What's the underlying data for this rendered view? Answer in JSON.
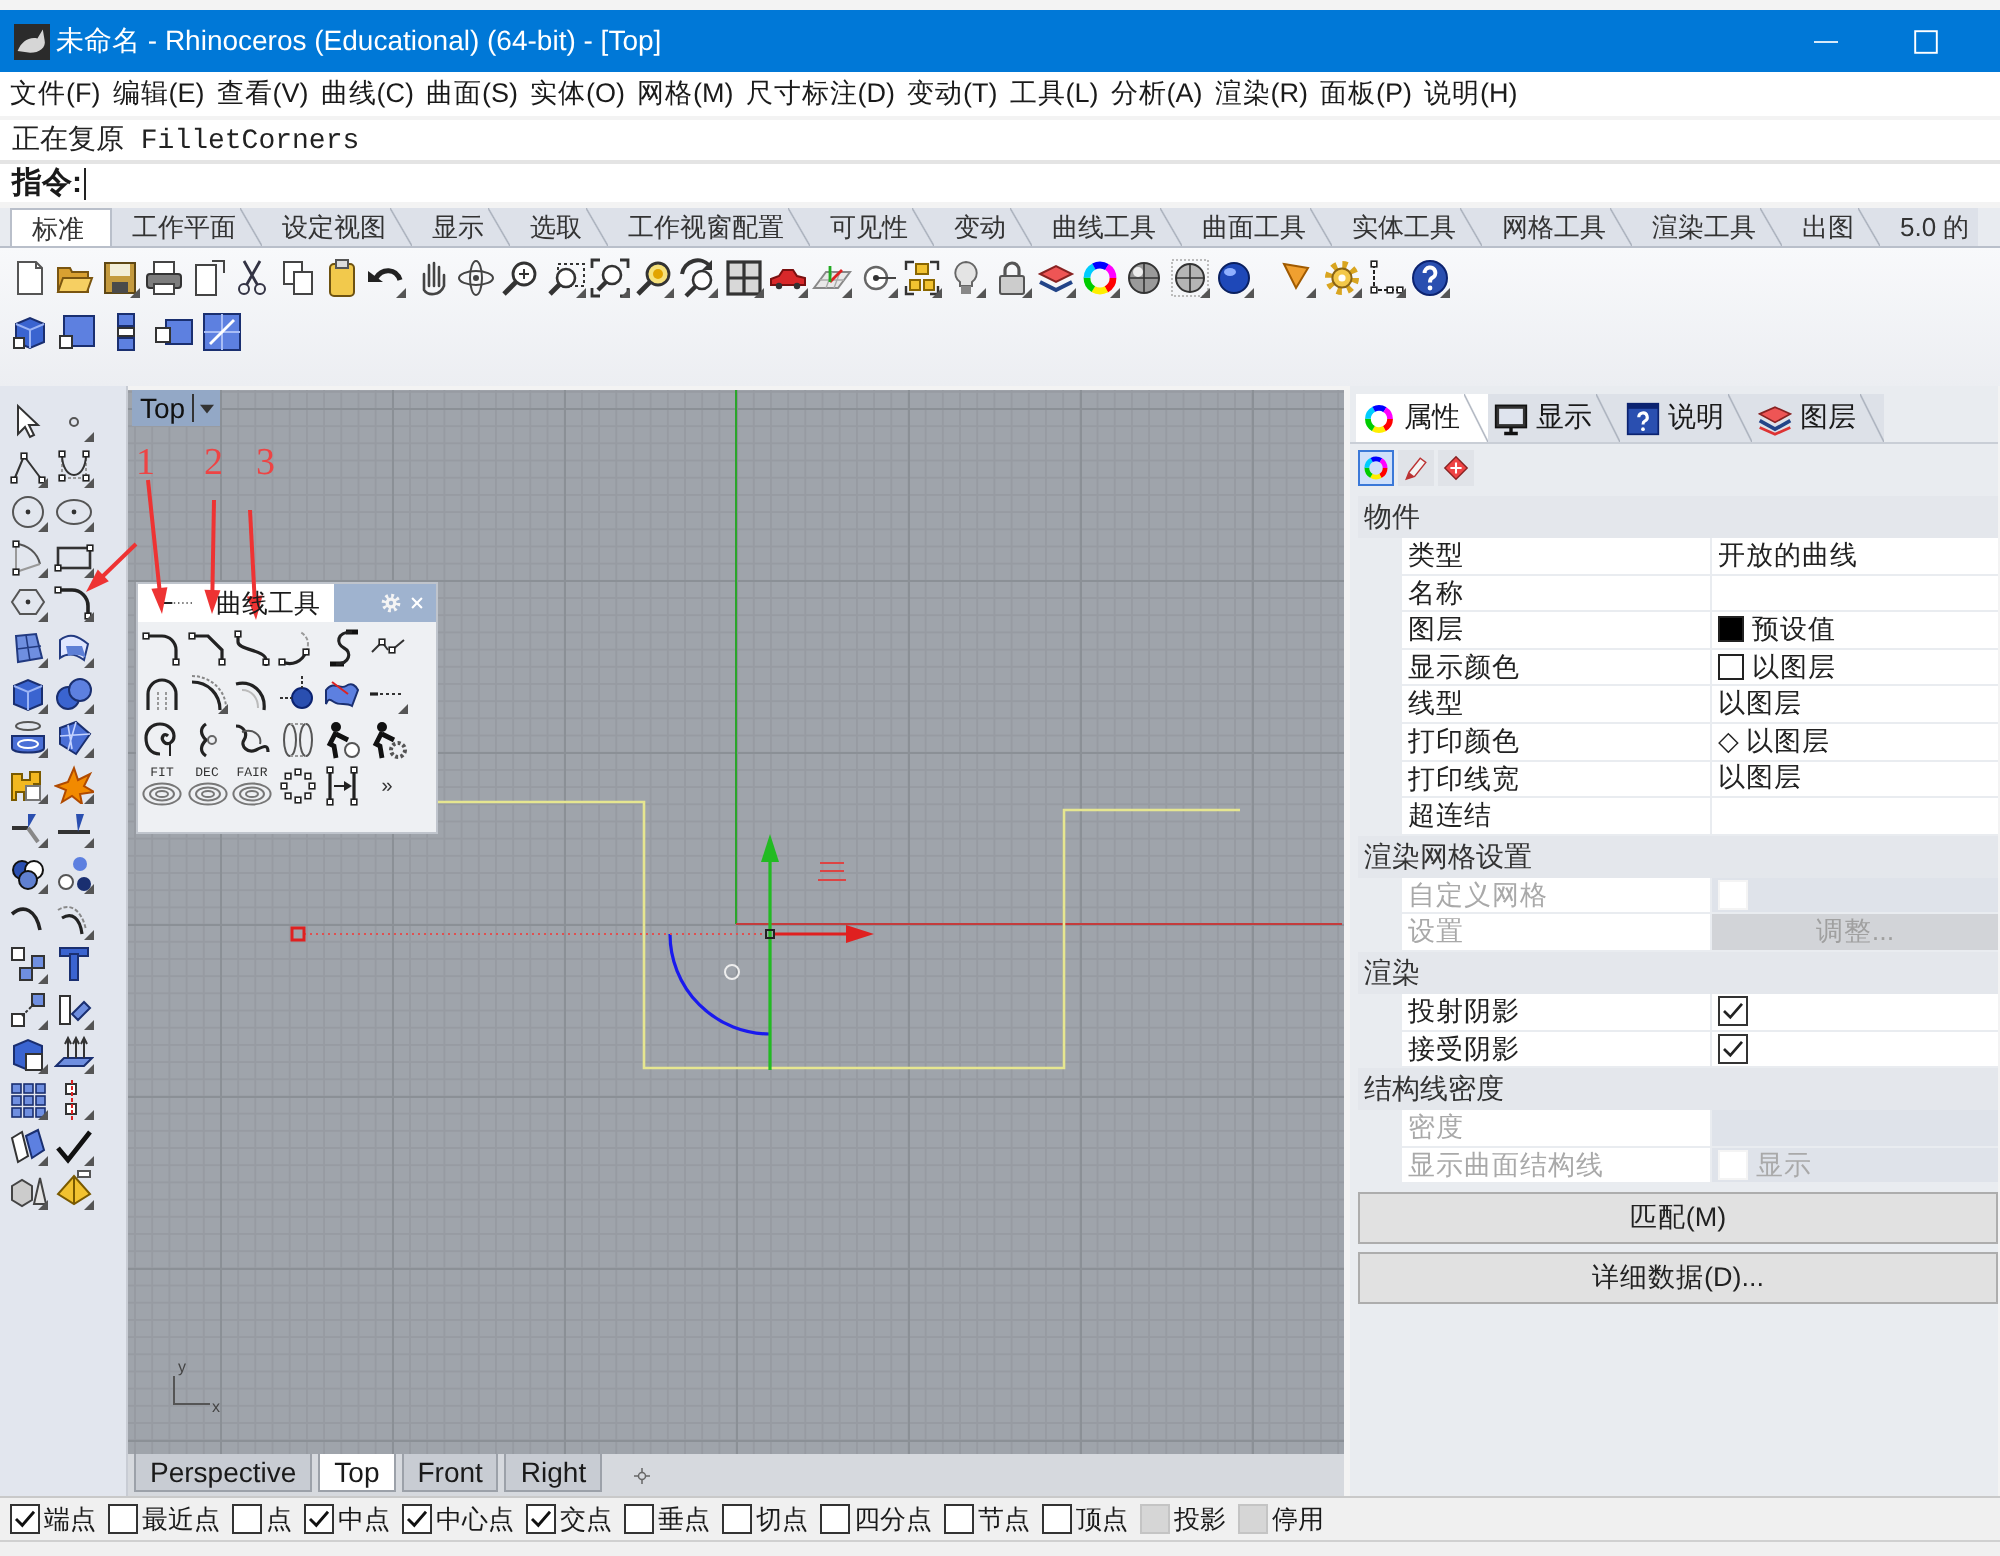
{
  "window": {
    "title": "未命名 - Rhinoceros (Educational) (64-bit) - [Top]"
  },
  "menu": [
    "文件(F)",
    "编辑(E)",
    "查看(V)",
    "曲线(C)",
    "曲面(S)",
    "实体(O)",
    "网格(M)",
    "尺寸标注(D)",
    "变动(T)",
    "工具(L)",
    "分析(A)",
    "渲染(R)",
    "面板(P)",
    "说明(H)"
  ],
  "command_line": {
    "history": "正在复原 FilletCorners",
    "prompt": "指令:"
  },
  "toolbar_tabs": [
    {
      "label": "标准",
      "selected": true
    },
    {
      "label": "工作平面",
      "selected": false
    },
    {
      "label": "设定视图",
      "selected": false
    },
    {
      "label": "显示",
      "selected": false
    },
    {
      "label": "选取",
      "selected": false
    },
    {
      "label": "工作视窗配置",
      "selected": false
    },
    {
      "label": "可见性",
      "selected": false
    },
    {
      "label": "变动",
      "selected": false
    },
    {
      "label": "曲线工具",
      "selected": false
    },
    {
      "label": "曲面工具",
      "selected": false
    },
    {
      "label": "实体工具",
      "selected": false
    },
    {
      "label": "网格工具",
      "selected": false
    },
    {
      "label": "渲染工具",
      "selected": false
    },
    {
      "label": "出图",
      "selected": false
    },
    {
      "label": "5.0 的",
      "selected": false
    }
  ],
  "viewport": {
    "title": "Top",
    "axis_labels": [
      "y",
      "x"
    ],
    "tabs": [
      {
        "label": "Perspective",
        "selected": false
      },
      {
        "label": "Top",
        "selected": true
      },
      {
        "label": "Front",
        "selected": false
      },
      {
        "label": "Right",
        "selected": false
      }
    ]
  },
  "curve_tools_popup": {
    "title": "曲线工具",
    "tool_labels": [
      "FIT",
      "DEC",
      "FAIR"
    ],
    "more": "»"
  },
  "annotations": [
    "1",
    "2",
    "3"
  ],
  "properties_panel": {
    "tabs": [
      {
        "label": "属性",
        "selected": true
      },
      {
        "label": "显示",
        "selected": false
      },
      {
        "label": "说明",
        "selected": false
      },
      {
        "label": "图层",
        "selected": false
      }
    ],
    "page_buttons": [
      {
        "selected": true
      },
      {
        "selected": false
      },
      {
        "selected": false
      }
    ],
    "sections": [
      {
        "title": "物件",
        "rows": [
          {
            "label": "类型",
            "kind": "text",
            "value": "开放的曲线",
            "disabled": false
          },
          {
            "label": "名称",
            "kind": "empty",
            "disabled": false
          },
          {
            "label": "图层",
            "kind": "swatch",
            "color": "#000000",
            "value": "预设值",
            "disabled": false
          },
          {
            "label": "显示颜色",
            "kind": "swatch",
            "color": "#ffffff",
            "value": "以图层",
            "disabled": false
          },
          {
            "label": "线型",
            "kind": "text",
            "value": "以图层",
            "disabled": false
          },
          {
            "label": "打印颜色",
            "kind": "text",
            "value": "◇ 以图层",
            "disabled": false
          },
          {
            "label": "打印线宽",
            "kind": "text",
            "value": "以图层",
            "disabled": false
          },
          {
            "label": "超连结",
            "kind": "empty",
            "disabled": false
          }
        ]
      },
      {
        "title": "渲染网格设置",
        "rows": [
          {
            "label": "自定义网格",
            "kind": "checkbox",
            "checked": false,
            "disabled": true
          },
          {
            "label": "设置",
            "kind": "button",
            "value": "调整...",
            "disabled": true
          }
        ]
      },
      {
        "title": "渲染",
        "rows": [
          {
            "label": "投射阴影",
            "kind": "checkbox",
            "checked": true,
            "disabled": false
          },
          {
            "label": "接受阴影",
            "kind": "checkbox",
            "checked": true,
            "disabled": false
          }
        ]
      },
      {
        "title": "结构线密度",
        "rows": [
          {
            "label": "密度",
            "kind": "empty",
            "disabled": true
          },
          {
            "label": "显示曲面结构线",
            "kind": "checkbox",
            "checked": false,
            "value": "显示",
            "disabled": true
          }
        ]
      }
    ],
    "buttons": [
      "匹配(M)",
      "详细数据(D)..."
    ]
  },
  "osnap": [
    {
      "label": "端点",
      "checked": true,
      "disabled": false
    },
    {
      "label": "最近点",
      "checked": false,
      "disabled": false
    },
    {
      "label": "点",
      "checked": false,
      "disabled": false
    },
    {
      "label": "中点",
      "checked": true,
      "disabled": false
    },
    {
      "label": "中心点",
      "checked": true,
      "disabled": false
    },
    {
      "label": "交点",
      "checked": true,
      "disabled": false
    },
    {
      "label": "垂点",
      "checked": false,
      "disabled": false
    },
    {
      "label": "切点",
      "checked": false,
      "disabled": false
    },
    {
      "label": "四分点",
      "checked": false,
      "disabled": false
    },
    {
      "label": "节点",
      "checked": false,
      "disabled": false
    },
    {
      "label": "顶点",
      "checked": false,
      "disabled": false
    },
    {
      "label": "投影",
      "checked": false,
      "disabled": true
    },
    {
      "label": "停用",
      "checked": false,
      "disabled": true
    }
  ]
}
